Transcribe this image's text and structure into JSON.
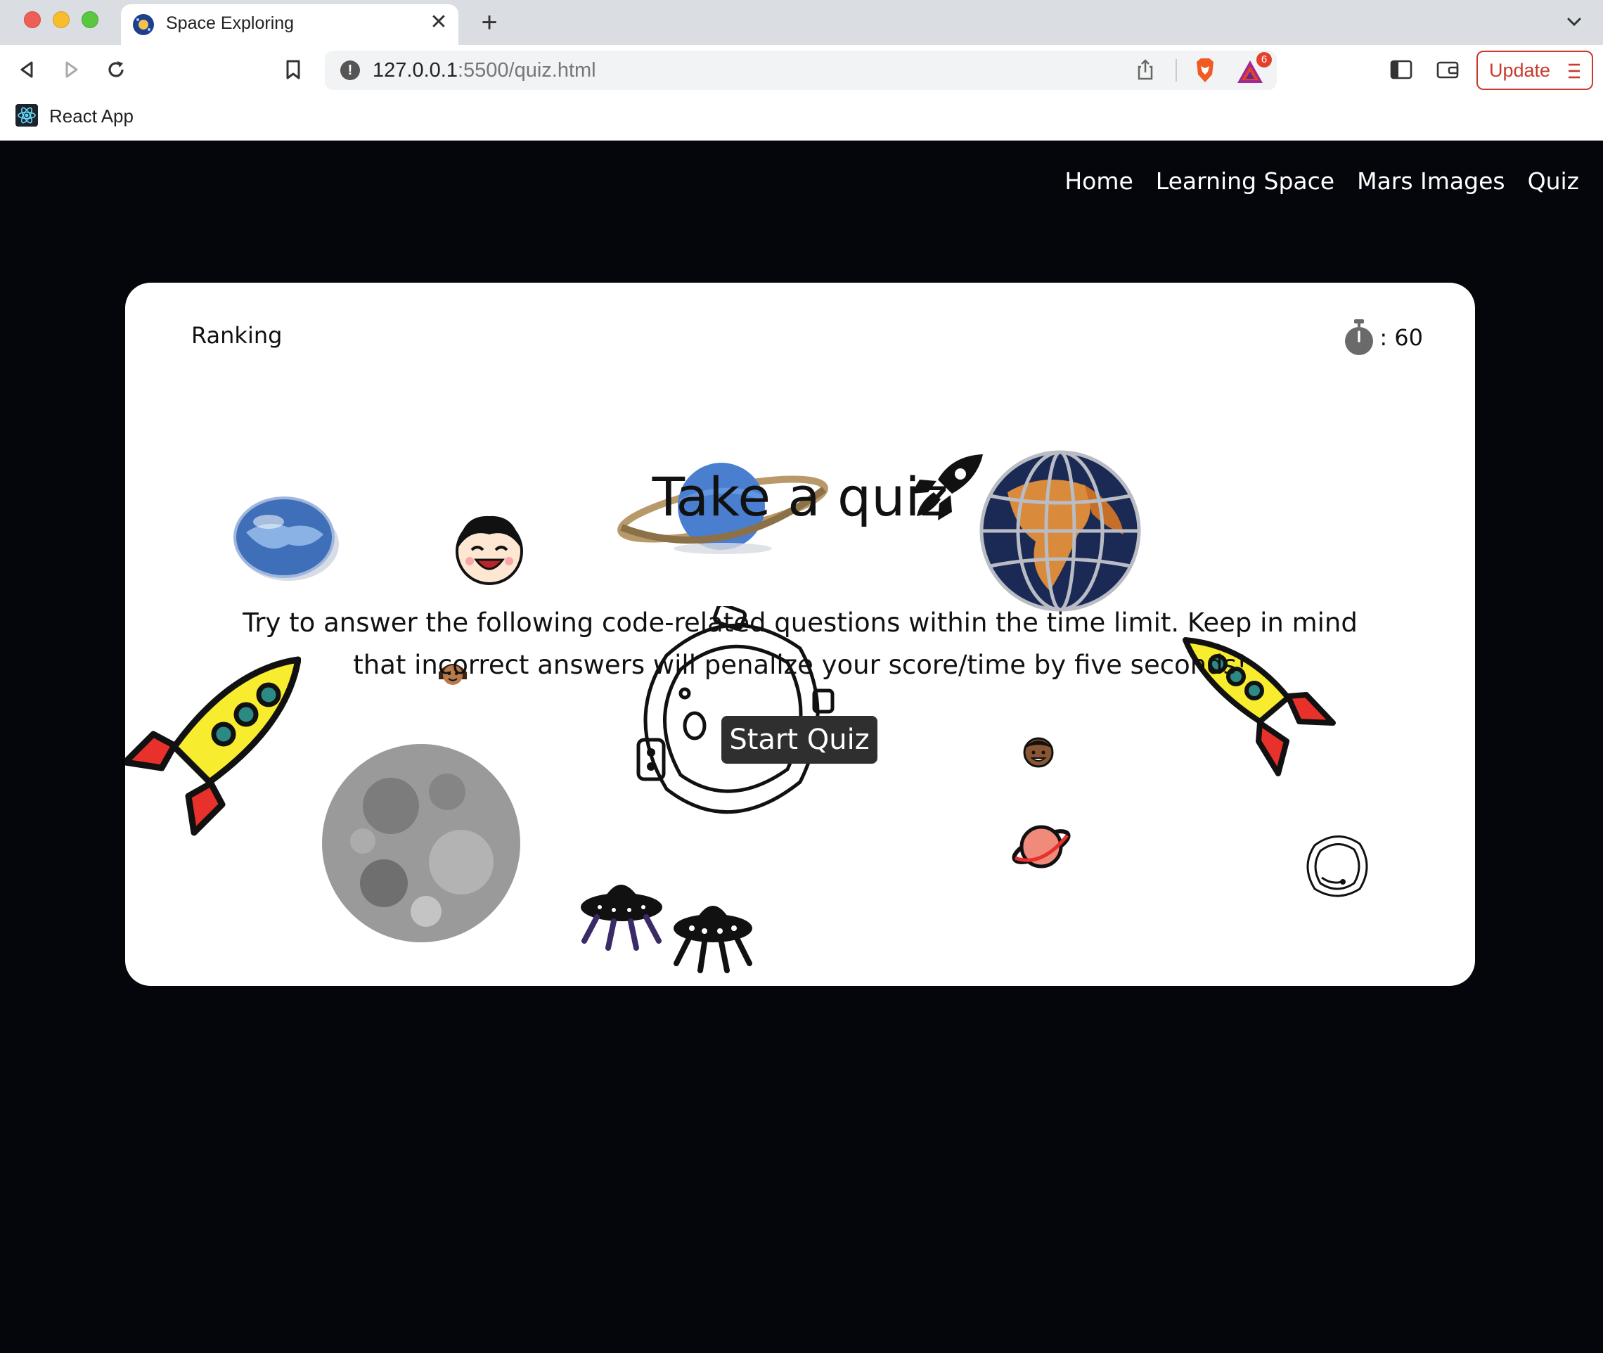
{
  "browser": {
    "tab_title": "Space Exploring",
    "tab_close": "✕",
    "new_tab": "+",
    "url_host": "127.0.0.1",
    "url_path": ":5500/quiz.html",
    "rewards_count": "6",
    "update_label": "Update",
    "bookmark_label": "React App"
  },
  "nav": {
    "items": [
      "Home",
      "Learning Space",
      "Mars Images",
      "Quiz"
    ]
  },
  "quiz": {
    "ranking_label": "Ranking",
    "timer_text": ": 60",
    "title": "Take a quiz",
    "description": "Try to answer the following code-related questions within the time limit. Keep in mind that incorrect answers will penalize your score/time by five seconds!",
    "start_label": "Start Quiz"
  },
  "icons": {
    "favicon": "planet-favicon-icon",
    "timer": "stopwatch-icon",
    "title_rocket": "rocket-icon",
    "decorations": [
      "globe-disc-icon",
      "smiling-face-icon",
      "saturn-icon",
      "earth-globe-icon",
      "rocket-icon",
      "rocket-icon",
      "astronaut-helmet-icon",
      "moon-icon",
      "ufo-icon",
      "ufo-icon",
      "planet-icon",
      "astronaut-helmet-icon",
      "face-icon",
      "face-icon"
    ]
  },
  "colors": {
    "page_background": "#05060c",
    "card_background": "#ffffff",
    "button_background": "#2f2f2f",
    "update_accent": "#c93a2c"
  }
}
